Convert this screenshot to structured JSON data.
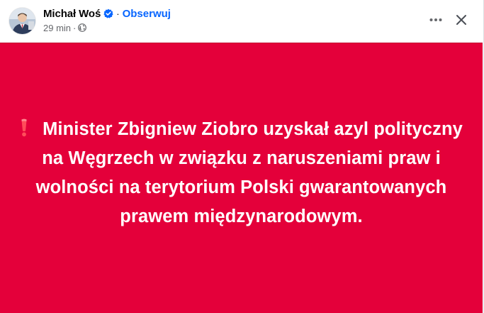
{
  "post": {
    "author_name": "Michał Woś",
    "follow_label": "Obserwuj",
    "separator": "·",
    "timestamp": "29 min",
    "meta_separator": "·",
    "body_text": "Minister Zbigniew Ziobro uzyskał azyl polityczny na Węgrzech w związku z naruszeniami praw i wolności na terytorium Polski gwarantowanych prawem międzynarodowym.",
    "background_color": "#e4003a",
    "text_color": "#ffffff"
  },
  "icons": {
    "verified": "verified-badge-icon",
    "audience": "globe-icon",
    "more": "more-horizontal-icon",
    "close": "close-icon",
    "emoji": "red-exclamation-icon"
  },
  "colors": {
    "accent": "#0866ff",
    "secondary_text": "#65676b",
    "primary_text": "#050505"
  }
}
